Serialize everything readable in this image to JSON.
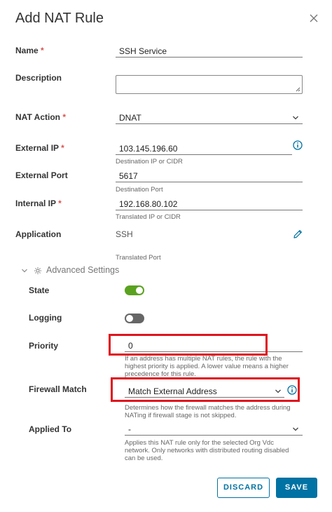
{
  "dialog": {
    "title": "Add NAT Rule"
  },
  "required_mark": "*",
  "fields": {
    "name": {
      "label": "Name",
      "value": "SSH Service"
    },
    "description": {
      "label": "Description",
      "value": ""
    },
    "nat_action": {
      "label": "NAT Action",
      "value": "DNAT"
    },
    "external_ip": {
      "label": "External IP",
      "value": "103.145.196.60",
      "help": "Destination IP or CIDR"
    },
    "external_port": {
      "label": "External Port",
      "value": "5617",
      "help": "Destination Port"
    },
    "internal_ip": {
      "label": "Internal IP",
      "value": "192.168.80.102",
      "help": "Translated IP or CIDR"
    },
    "application": {
      "label": "Application",
      "value": "SSH",
      "help": "Translated Port"
    }
  },
  "advanced": {
    "label": "Advanced Settings",
    "state": {
      "label": "State",
      "on": true
    },
    "logging": {
      "label": "Logging",
      "on": false
    },
    "priority": {
      "label": "Priority",
      "value": "0",
      "help_lines": [
        "If an address has multiple NAT rules, the rule with the",
        "highest priority is applied. A lower value means a higher",
        "precedence for this rule."
      ]
    },
    "firewall_match": {
      "label": "Firewall Match",
      "value": "Match External Address",
      "help_lines": [
        "Determines how the firewall matches the address during",
        "NATing if firewall stage is not skipped."
      ]
    },
    "applied_to": {
      "label": "Applied To",
      "value": "-",
      "help_lines": [
        "Applies this NAT rule only for the selected Org Vdc",
        "network. Only networks with distributed routing disabled",
        "can be used."
      ]
    }
  },
  "buttons": {
    "discard": "DISCARD",
    "save": "SAVE"
  },
  "colors": {
    "accent": "#0072a3",
    "toggle_on": "#5aa220",
    "toggle_off": "#666666",
    "highlight": "#e0141e"
  }
}
